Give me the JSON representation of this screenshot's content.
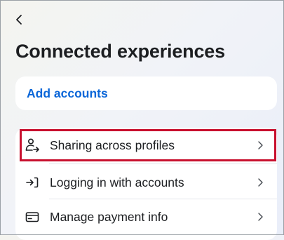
{
  "header": {
    "title": "Connected experiences",
    "back_icon": "chevron-left-icon"
  },
  "add_section": {
    "link_label": "Add accounts",
    "link_color": "#0a66d8"
  },
  "menu": {
    "items": [
      {
        "label": "Sharing across profiles",
        "icon": "share-user-icon",
        "highlighted": true
      },
      {
        "label": "Logging in with accounts",
        "icon": "login-arrow-icon",
        "highlighted": false
      },
      {
        "label": "Manage payment info",
        "icon": "credit-card-icon",
        "highlighted": false
      }
    ]
  },
  "colors": {
    "highlight": "#c8102e",
    "background": "#f1f3f8"
  }
}
